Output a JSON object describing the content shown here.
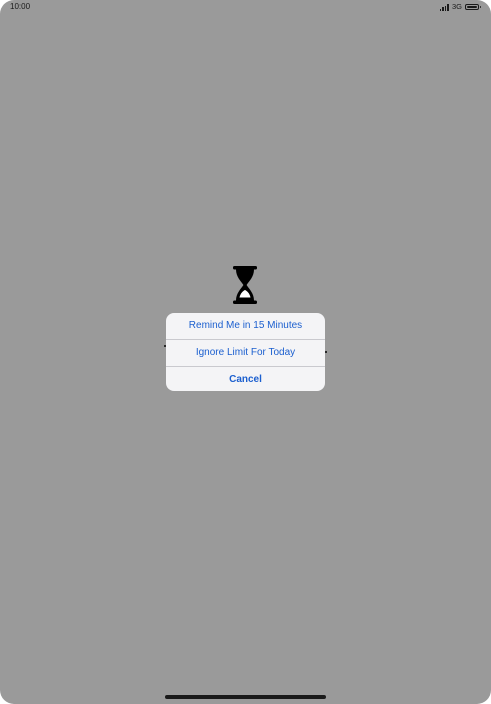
{
  "status_bar": {
    "time": "10:00",
    "network": "3G",
    "icons": [
      "signal-icon",
      "battery-icon"
    ]
  },
  "screen_time": {
    "icon": "hourglass-icon"
  },
  "alert_sheet": {
    "actions": [
      {
        "label": "Remind Me in 15 Minutes"
      },
      {
        "label": "Ignore Limit For Today"
      },
      {
        "label": "Cancel"
      }
    ]
  },
  "colors": {
    "dimmed_background": "#9a9a9a",
    "sheet_background": "#f4f4f6",
    "action_tint": "#1b5fcf"
  }
}
